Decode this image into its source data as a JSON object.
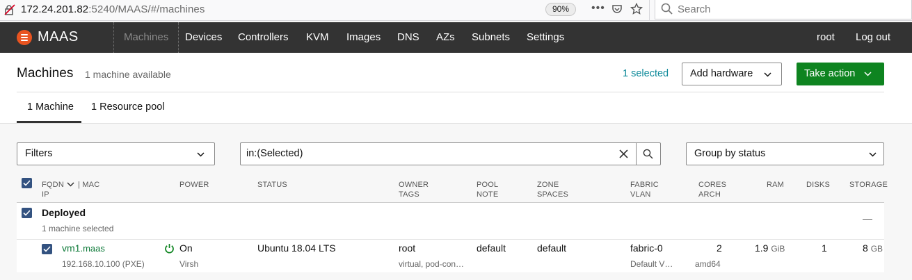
{
  "browser": {
    "url_host": "172.24.201.82",
    "url_rest": ":5240/MAAS/#/machines",
    "zoom": "90%",
    "search_placeholder": "Search"
  },
  "nav": {
    "brand": "MAAS",
    "items": [
      {
        "label": "Machines",
        "active": true
      },
      {
        "label": "Devices"
      },
      {
        "label": "Controllers"
      },
      {
        "label": "KVM"
      },
      {
        "label": "Images"
      },
      {
        "label": "DNS"
      },
      {
        "label": "AZs"
      },
      {
        "label": "Subnets"
      },
      {
        "label": "Settings"
      }
    ],
    "user": "root",
    "logout": "Log out"
  },
  "header": {
    "title": "Machines",
    "count": "1 machine available",
    "selected": "1 selected",
    "add_hardware": "Add hardware",
    "take_action": "Take action",
    "tabs": [
      "1 Machine",
      "1 Resource pool"
    ]
  },
  "controls": {
    "filters": "Filters",
    "search_value": "in:(Selected)",
    "group_by": "Group by status"
  },
  "table": {
    "headers": {
      "fqdn": "FQDN",
      "mac": "| MAC",
      "ip": "IP",
      "power": "POWER",
      "status": "STATUS",
      "owner": "OWNER",
      "tags": "TAGS",
      "pool": "POOL",
      "note": "NOTE",
      "zone": "ZONE",
      "spaces": "SPACES",
      "fabric": "FABRIC",
      "vlan": "VLAN",
      "cores": "CORES",
      "arch": "ARCH",
      "ram": "RAM",
      "disks": "DISKS",
      "storage": "STORAGE"
    },
    "group": {
      "name": "Deployed",
      "summary": "1 machine selected",
      "collapse": "—"
    },
    "row": {
      "fqdn": "vm1",
      "domain": ".maas",
      "ip": "192.168.10.100 (PXE)",
      "power": "On",
      "power_type": "Virsh",
      "status": "Ubuntu 18.04 LTS",
      "owner": "root",
      "tags": "virtual, pod-con…",
      "pool": "default",
      "zone": "default",
      "fabric": "fabric-0",
      "vlan": "Default V…",
      "cores": "2",
      "arch": "amd64",
      "ram": "1.9",
      "ram_unit": "GiB",
      "disks": "1",
      "storage": "8",
      "storage_unit": "GB"
    }
  },
  "colors": {
    "accent_orange": "#e95420",
    "action_green": "#0e8420",
    "link_teal": "#0e8a9a",
    "checkbox_blue": "#335280",
    "navbar": "#333333"
  }
}
